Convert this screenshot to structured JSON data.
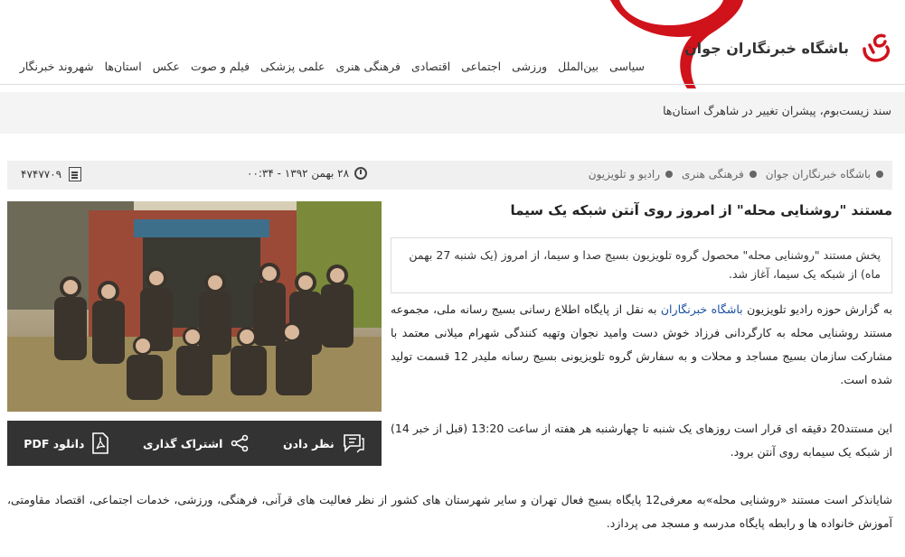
{
  "site": {
    "name": "باشگاه خبرنگاران جوان"
  },
  "nav": {
    "items": [
      "سیاسی",
      "بین‌الملل",
      "ورزشی",
      "اجتماعی",
      "اقتصادی",
      "فرهنگی هنری",
      "علمی پزشکی",
      "فیلم و صوت",
      "عکس",
      "استان‌ها",
      "شهروند خبرنگار"
    ]
  },
  "ticker": {
    "text": "سند زیست‌بوم، پیشران تغییر در شاهرگ استان‌ها"
  },
  "meta": {
    "breadcrumb": [
      "باشگاه خبرنگاران جوان",
      "فرهنگی هنری",
      "رادیو و تلویزیون"
    ],
    "date": "۲۸ بهمن ۱۳۹۲ - ۰۰:۳۴",
    "news_id": "۴۷۴۷۷۰۹"
  },
  "article": {
    "title": "مستند \"روشنایی محله\" از امروز روی آنتن شبکه یک سیما",
    "lead": "پخش مستند \"روشنایی محله\" محصول گروه تلویزیون بسیج صدا و سیما، از امروز (یک شنبه 27 بهمن ماه) از شبکه یک سیما، آغاز شد.",
    "p1_before": "به گزارش حوزه رادیو تلویزیون ",
    "p1_link": "باشگاه خبرنگاران",
    "p1_after": " به نقل از  پایگاه اطلاع رسانی بسیج رسانه ملی، مجموعه مستند روشنایی محله به کارگردانی فرزاد خوش دست وامید نجوان وتهیه کنندگی شهرام میلانی معتمد با مشارکت سازمان بسیج مساجد و محلات و به سفارش گروه تلویزیونی بسیج رسانه ملیدر 12 قسمت تولید شده است.",
    "p2": "این مستند20 دقیقه ای قرار است روزهای یک شنبه تا چهارشنبه هر هفته از ساعت 13:20 (قبل از خبر 14) از شبکه یک سیمابه روی آنتن برود.",
    "p3": "شایانذکر است مستند «روشنایی محله»به معرفی12 پایگاه بسیج فعال تهران و سایر شهرستان های کشور از نظر فعالیت های قرآنی، فرهنگی، ورزشی، خدمات اجتماعی، اقتصاد مقاومتی، آموزش خانواده ها و رابطه پایگاه مدرسه و مسجد می پردازد."
  },
  "actions": {
    "comment": "نظر دادن",
    "share": "اشتراک گذاری",
    "pdf": "دانلود PDF"
  },
  "colors": {
    "brand_red": "#d0121b",
    "action_bar": "#333333",
    "link": "#1a4fa0"
  }
}
